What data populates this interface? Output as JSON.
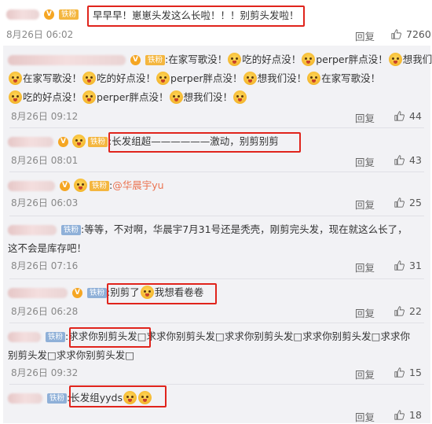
{
  "comments": [
    {
      "id": "c0",
      "name_hidden": true,
      "badge": "铁粉",
      "text": "早早早！崽崽头发这么长啦！！！别剪头发啦！",
      "date": "8月26日 06:02",
      "reply": "回复",
      "likes": "7260"
    },
    {
      "id": "c1",
      "badge": "铁粉",
      "text_parts": [
        ":在家写歌没！",
        "吃的好点没！",
        "perper胖点没！",
        "想我们没！",
        "在家写歌没！",
        "吃的好点没！",
        "perper胖点没！",
        "想我们没！",
        "在家写歌没！",
        "吃的好点没！",
        "perper胖点没！",
        "想我们没！"
      ],
      "date": "8月26日 09:12",
      "reply": "回复",
      "likes": "44"
    },
    {
      "id": "c2",
      "badge": "铁粉",
      "text": ":长发组超——————激动，别剪别剪",
      "date": "8月26日 08:01",
      "reply": "回复",
      "likes": "43"
    },
    {
      "id": "c3",
      "badge": "铁粉",
      "text_prefix": ":",
      "mention": "@华晨宇yu",
      "date": "8月26日 06:03",
      "reply": "回复",
      "likes": "25"
    },
    {
      "id": "c4",
      "badge": "铁粉",
      "text_line1": ":等等，不对啊，华晨宇7月31号还是秃壳，刚剪完头发，现在就这么长了，",
      "text_line2": "这不会是库存吧！",
      "date": "8月26日 07:16",
      "reply": "回复",
      "likes": "31"
    },
    {
      "id": "c5",
      "badge": "铁粉",
      "text_a": ":别剪了",
      "text_b": "我想看卷卷",
      "date": "8月26日 06:28",
      "reply": "回复",
      "likes": "22"
    },
    {
      "id": "c6",
      "badge": "铁粉",
      "text_line1": ":求求你别剪头发□求求你别剪头发□求求你别剪头发□求求你别剪头发□求求你",
      "text_line2": "别剪头发□求求你别剪头发□",
      "date": "8月26日 09:32",
      "reply": "回复",
      "likes": "15"
    },
    {
      "id": "c7",
      "badge": "铁粉",
      "text": ":长发组yyds",
      "date": "",
      "reply": "回复",
      "likes": "18"
    }
  ],
  "icons": {
    "like": "thumbs-up-icon",
    "emoji": "face-emoji-icon",
    "vip": "v-badge-icon"
  },
  "colors": {
    "highlight": "#e0241c",
    "mention": "#eb7350",
    "panel_bg": "#f2f2f5"
  }
}
